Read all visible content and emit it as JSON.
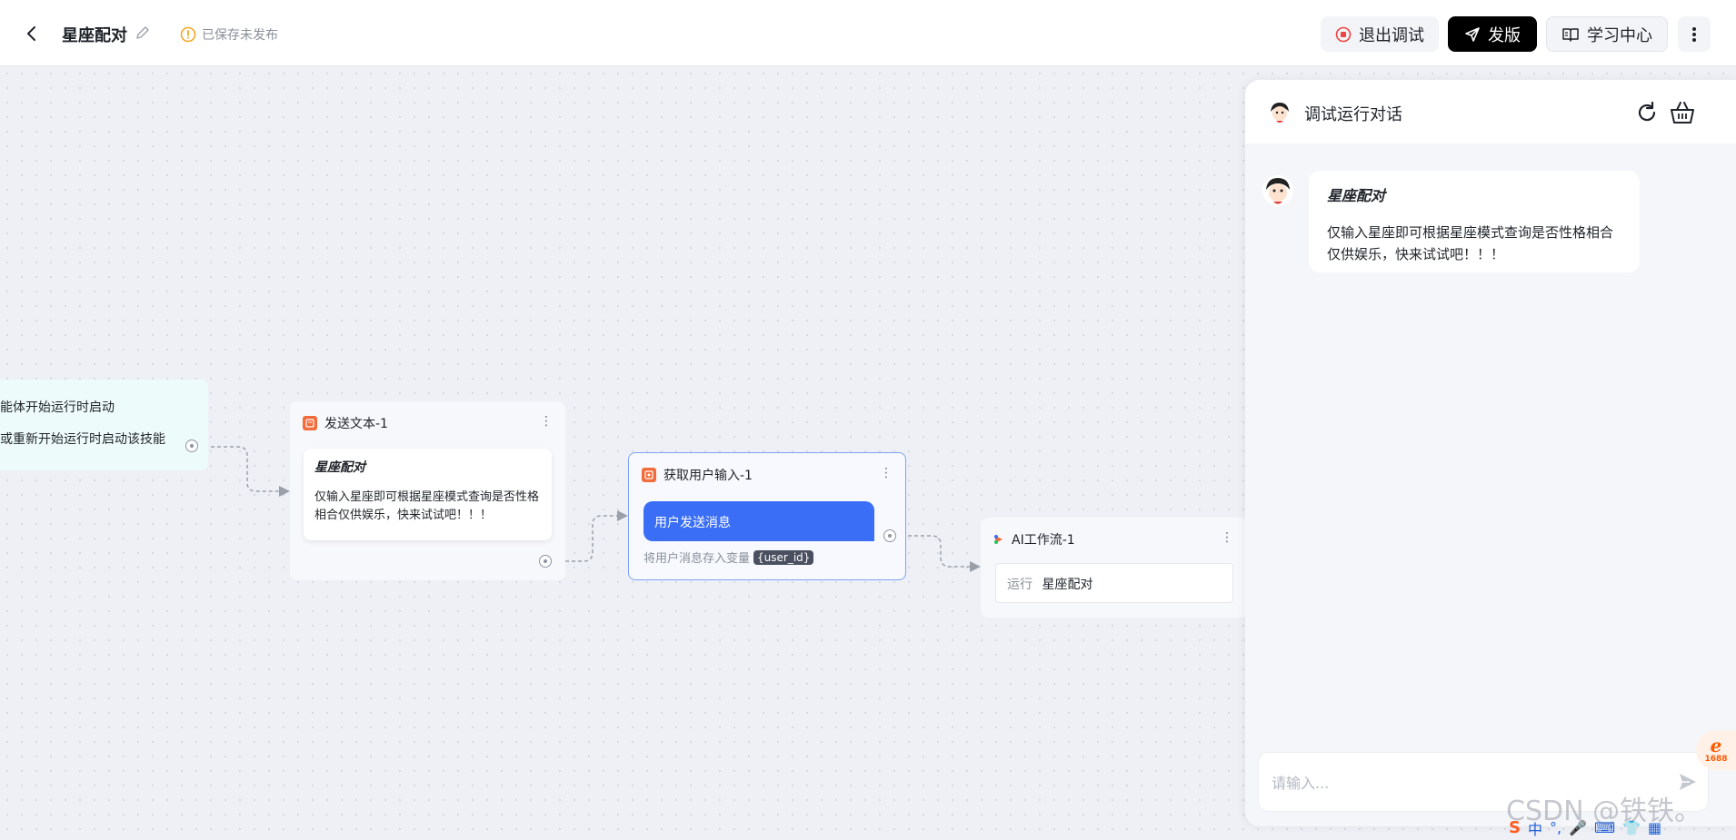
{
  "header": {
    "title": "星座配对",
    "save_status": "已保存未发布",
    "exit_debug_label": "退出调试",
    "publish_label": "发版",
    "learn_label": "学习中心"
  },
  "canvas": {
    "start_node": {
      "line1": "能体开始运行时启动",
      "line2": "或重新开始运行时启动该技能"
    },
    "send_text_node": {
      "title": "发送文本-1",
      "card_title": "星座配对",
      "card_body": "仅输入星座即可根据星座模式查询是否性格相合仅供娱乐，快来试试吧！！！"
    },
    "user_input_node": {
      "title": "获取用户输入-1",
      "bubble_text": "用户发送消息",
      "store_label": "将用户消息存入变量",
      "variable": "{user_id}"
    },
    "ai_workflow_node": {
      "title": "AI工作流-1",
      "run_key": "运行",
      "run_value": "星座配对"
    }
  },
  "chat": {
    "title": "调试运行对话",
    "message": {
      "title": "星座配对",
      "body": "仅输入星座即可根据星座模式查询是否性格相合仅供娱乐，快来试试吧！！！"
    },
    "input_placeholder": "请输入..."
  },
  "overlay": {
    "watermark": "CSDN @铁铁。",
    "ime_chinese": "中",
    "badge_1688": "1688"
  },
  "colors": {
    "accent_blue": "#3a6ef6",
    "node_icon_orange": "#f26b3a",
    "publish_bg": "#000000"
  }
}
